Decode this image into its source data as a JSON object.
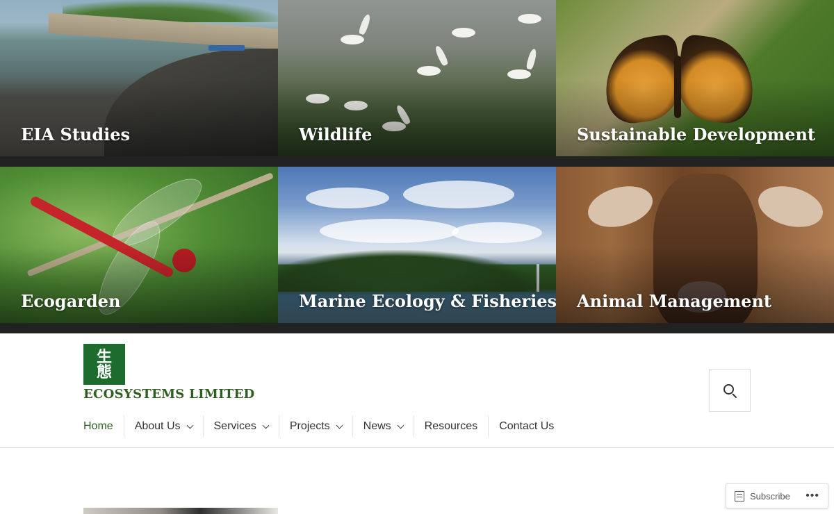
{
  "tiles": [
    {
      "label": "EIA Studies"
    },
    {
      "label": "Wildlife"
    },
    {
      "label": "Sustainable Development"
    },
    {
      "label": "Ecogarden"
    },
    {
      "label": "Marine Ecology & Fisheries"
    },
    {
      "label": "Animal Management"
    }
  ],
  "logo": {
    "chars_line1": "生",
    "chars_line2": "態"
  },
  "site_title": "ECOSYSTEMS LIMITED",
  "nav": {
    "items": [
      {
        "label": "Home",
        "active": true
      },
      {
        "label": "About Us",
        "has_dropdown": true
      },
      {
        "label": "Services",
        "has_dropdown": true
      },
      {
        "label": "Projects",
        "has_dropdown": true
      },
      {
        "label": "News",
        "has_dropdown": true
      },
      {
        "label": "Resources"
      },
      {
        "label": "Contact Us"
      }
    ]
  },
  "subscribe": {
    "label": "Subscribe",
    "more": "•••"
  },
  "colors": {
    "brand_green": "#1e6b2e",
    "title_green": "#2f5d22",
    "tile_gap": "#222222"
  },
  "icons": [
    "search-icon",
    "chevron-down-icon",
    "subscribe-icon",
    "more-icon"
  ]
}
